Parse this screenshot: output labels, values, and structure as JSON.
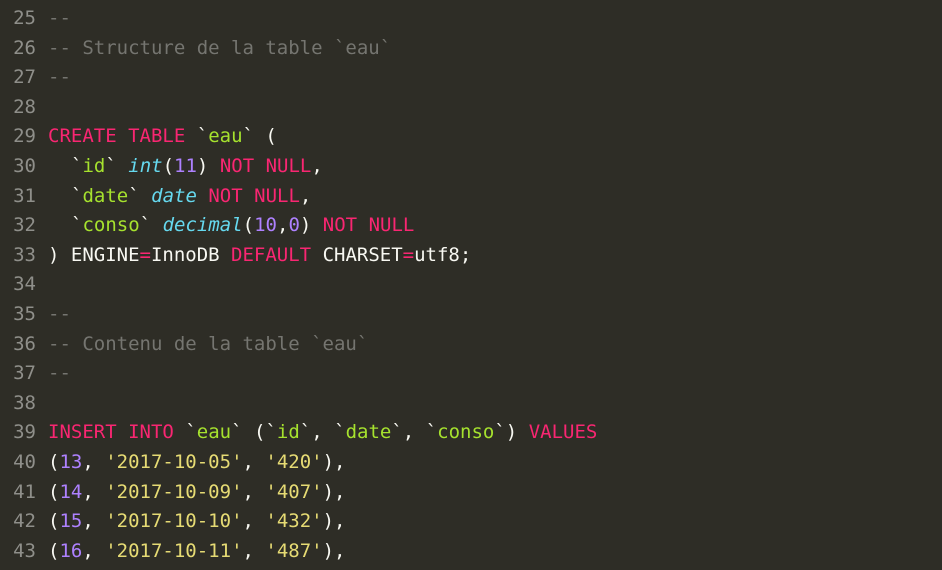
{
  "lines": [
    {
      "num": 25,
      "tokens": [
        {
          "cls": "comment",
          "t": "--"
        }
      ]
    },
    {
      "num": 26,
      "tokens": [
        {
          "cls": "comment",
          "t": "-- Structure de la table `eau`"
        }
      ]
    },
    {
      "num": 27,
      "tokens": [
        {
          "cls": "comment",
          "t": "--"
        }
      ]
    },
    {
      "num": 28,
      "tokens": []
    },
    {
      "num": 29,
      "tokens": [
        {
          "cls": "keyword",
          "t": "CREATE"
        },
        {
          "cls": "plain",
          "t": " "
        },
        {
          "cls": "keyword",
          "t": "TABLE"
        },
        {
          "cls": "plain",
          "t": " "
        },
        {
          "cls": "backtick",
          "t": "`"
        },
        {
          "cls": "identifier",
          "t": "eau"
        },
        {
          "cls": "backtick",
          "t": "`"
        },
        {
          "cls": "plain",
          "t": " ("
        }
      ]
    },
    {
      "num": 30,
      "indent": true,
      "tokens": [
        {
          "cls": "backtick",
          "t": "`"
        },
        {
          "cls": "identifier",
          "t": "id"
        },
        {
          "cls": "backtick",
          "t": "`"
        },
        {
          "cls": "plain",
          "t": " "
        },
        {
          "cls": "type",
          "t": "int"
        },
        {
          "cls": "plain",
          "t": "("
        },
        {
          "cls": "number",
          "t": "11"
        },
        {
          "cls": "plain",
          "t": ") "
        },
        {
          "cls": "keyword",
          "t": "NOT"
        },
        {
          "cls": "plain",
          "t": " "
        },
        {
          "cls": "keyword",
          "t": "NULL"
        },
        {
          "cls": "plain",
          "t": ","
        }
      ]
    },
    {
      "num": 31,
      "indent": true,
      "tokens": [
        {
          "cls": "backtick",
          "t": "`"
        },
        {
          "cls": "identifier",
          "t": "date"
        },
        {
          "cls": "backtick",
          "t": "`"
        },
        {
          "cls": "plain",
          "t": " "
        },
        {
          "cls": "type",
          "t": "date"
        },
        {
          "cls": "plain",
          "t": " "
        },
        {
          "cls": "keyword",
          "t": "NOT"
        },
        {
          "cls": "plain",
          "t": " "
        },
        {
          "cls": "keyword",
          "t": "NULL"
        },
        {
          "cls": "plain",
          "t": ","
        }
      ]
    },
    {
      "num": 32,
      "indent": true,
      "tokens": [
        {
          "cls": "backtick",
          "t": "`"
        },
        {
          "cls": "identifier",
          "t": "conso"
        },
        {
          "cls": "backtick",
          "t": "`"
        },
        {
          "cls": "plain",
          "t": " "
        },
        {
          "cls": "type",
          "t": "decimal"
        },
        {
          "cls": "plain",
          "t": "("
        },
        {
          "cls": "number",
          "t": "10"
        },
        {
          "cls": "plain",
          "t": ","
        },
        {
          "cls": "number",
          "t": "0"
        },
        {
          "cls": "plain",
          "t": ") "
        },
        {
          "cls": "keyword",
          "t": "NOT"
        },
        {
          "cls": "plain",
          "t": " "
        },
        {
          "cls": "keyword",
          "t": "NULL"
        }
      ]
    },
    {
      "num": 33,
      "tokens": [
        {
          "cls": "plain",
          "t": ") ENGINE"
        },
        {
          "cls": "keyword",
          "t": "="
        },
        {
          "cls": "plain",
          "t": "InnoDB "
        },
        {
          "cls": "keyword",
          "t": "DEFAULT"
        },
        {
          "cls": "plain",
          "t": " CHARSET"
        },
        {
          "cls": "keyword",
          "t": "="
        },
        {
          "cls": "plain",
          "t": "utf8;"
        }
      ]
    },
    {
      "num": 34,
      "tokens": []
    },
    {
      "num": 35,
      "tokens": [
        {
          "cls": "comment",
          "t": "--"
        }
      ]
    },
    {
      "num": 36,
      "tokens": [
        {
          "cls": "comment",
          "t": "-- Contenu de la table `eau`"
        }
      ]
    },
    {
      "num": 37,
      "tokens": [
        {
          "cls": "comment",
          "t": "--"
        }
      ]
    },
    {
      "num": 38,
      "tokens": []
    },
    {
      "num": 39,
      "tokens": [
        {
          "cls": "keyword",
          "t": "INSERT"
        },
        {
          "cls": "plain",
          "t": " "
        },
        {
          "cls": "keyword",
          "t": "INTO"
        },
        {
          "cls": "plain",
          "t": " "
        },
        {
          "cls": "backtick",
          "t": "`"
        },
        {
          "cls": "identifier",
          "t": "eau"
        },
        {
          "cls": "backtick",
          "t": "`"
        },
        {
          "cls": "plain",
          "t": " ("
        },
        {
          "cls": "backtick",
          "t": "`"
        },
        {
          "cls": "identifier",
          "t": "id"
        },
        {
          "cls": "backtick",
          "t": "`"
        },
        {
          "cls": "plain",
          "t": ", "
        },
        {
          "cls": "backtick",
          "t": "`"
        },
        {
          "cls": "identifier",
          "t": "date"
        },
        {
          "cls": "backtick",
          "t": "`"
        },
        {
          "cls": "plain",
          "t": ", "
        },
        {
          "cls": "backtick",
          "t": "`"
        },
        {
          "cls": "identifier",
          "t": "conso"
        },
        {
          "cls": "backtick",
          "t": "`"
        },
        {
          "cls": "plain",
          "t": ") "
        },
        {
          "cls": "keyword",
          "t": "VALUES"
        }
      ]
    },
    {
      "num": 40,
      "tokens": [
        {
          "cls": "plain",
          "t": "("
        },
        {
          "cls": "number",
          "t": "13"
        },
        {
          "cls": "plain",
          "t": ", "
        },
        {
          "cls": "string",
          "t": "'2017-10-05'"
        },
        {
          "cls": "plain",
          "t": ", "
        },
        {
          "cls": "string",
          "t": "'420'"
        },
        {
          "cls": "plain",
          "t": "),"
        }
      ]
    },
    {
      "num": 41,
      "tokens": [
        {
          "cls": "plain",
          "t": "("
        },
        {
          "cls": "number",
          "t": "14"
        },
        {
          "cls": "plain",
          "t": ", "
        },
        {
          "cls": "string",
          "t": "'2017-10-09'"
        },
        {
          "cls": "plain",
          "t": ", "
        },
        {
          "cls": "string",
          "t": "'407'"
        },
        {
          "cls": "plain",
          "t": "),"
        }
      ]
    },
    {
      "num": 42,
      "tokens": [
        {
          "cls": "plain",
          "t": "("
        },
        {
          "cls": "number",
          "t": "15"
        },
        {
          "cls": "plain",
          "t": ", "
        },
        {
          "cls": "string",
          "t": "'2017-10-10'"
        },
        {
          "cls": "plain",
          "t": ", "
        },
        {
          "cls": "string",
          "t": "'432'"
        },
        {
          "cls": "plain",
          "t": "),"
        }
      ]
    },
    {
      "num": 43,
      "tokens": [
        {
          "cls": "plain",
          "t": "("
        },
        {
          "cls": "number",
          "t": "16"
        },
        {
          "cls": "plain",
          "t": ", "
        },
        {
          "cls": "string",
          "t": "'2017-10-11'"
        },
        {
          "cls": "plain",
          "t": ", "
        },
        {
          "cls": "string",
          "t": "'487'"
        },
        {
          "cls": "plain",
          "t": "),"
        }
      ]
    }
  ]
}
